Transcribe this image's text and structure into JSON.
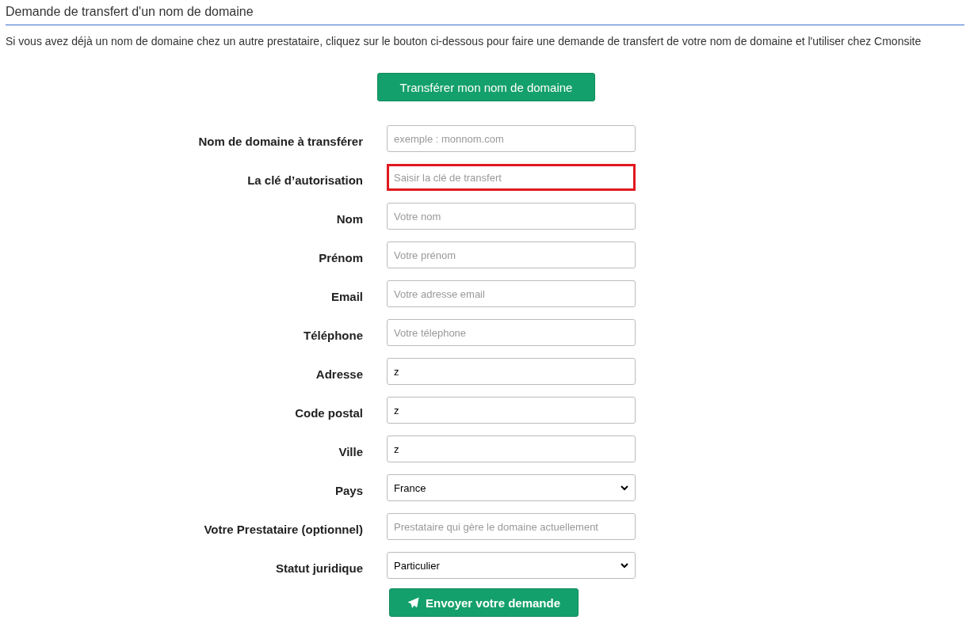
{
  "title": "Demande de transfert d'un nom de domaine",
  "intro": "Si vous avez déjà un nom de domaine chez un autre prestataire, cliquez sur le bouton ci-dessous pour faire une demande de transfert de votre nom de domaine et l'utiliser chez Cmonsite",
  "transfer_button": "Transférer mon nom de domaine",
  "fields": [
    {
      "label": "Nom de domaine à transférer",
      "kind": "text",
      "placeholder": "exemple : monnom.com",
      "highlighted": false
    },
    {
      "label": "La clé d’autorisation",
      "kind": "text",
      "placeholder": "Saisir la clé de transfert",
      "highlighted": true
    },
    {
      "label": "Nom",
      "kind": "text",
      "placeholder": "Votre nom",
      "highlighted": false
    },
    {
      "label": "Prénom",
      "kind": "text",
      "placeholder": "Votre prénom",
      "highlighted": false
    },
    {
      "label": "Email",
      "kind": "text",
      "placeholder": "Votre adresse email",
      "highlighted": false
    },
    {
      "label": "Téléphone",
      "kind": "text",
      "placeholder": "Votre télephone",
      "highlighted": false
    },
    {
      "label": "Adresse",
      "kind": "text",
      "value": "z",
      "highlighted": false
    },
    {
      "label": "Code postal",
      "kind": "text",
      "value": "z",
      "highlighted": false
    },
    {
      "label": "Ville",
      "kind": "text",
      "value": "z",
      "highlighted": false
    },
    {
      "label": "Pays",
      "kind": "select",
      "value": "France",
      "highlighted": false
    },
    {
      "label": "Votre Prestataire (optionnel)",
      "kind": "text",
      "placeholder": "Prestataire qui gère le domaine actuellement",
      "highlighted": false
    },
    {
      "label": "Statut juridique",
      "kind": "select",
      "value": "Particulier",
      "highlighted": false
    }
  ],
  "submit_button": "Envoyer votre demande"
}
